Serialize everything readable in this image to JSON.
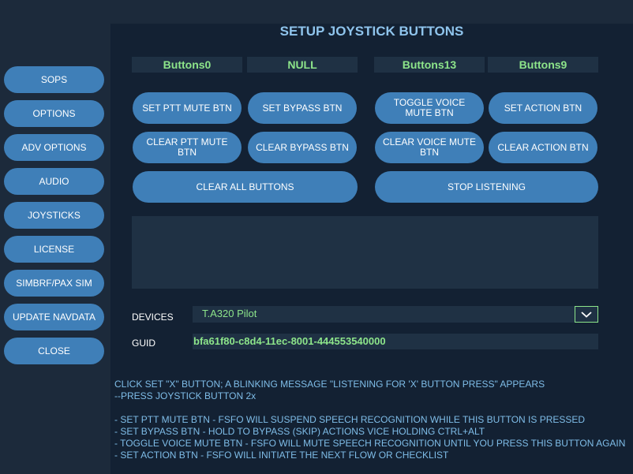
{
  "title": "SETUP JOYSTICK BUTTONS",
  "sidebar": {
    "items": [
      {
        "label": "SOPS"
      },
      {
        "label": "OPTIONS"
      },
      {
        "label": "ADV OPTIONS"
      },
      {
        "label": "AUDIO"
      },
      {
        "label": "JOYSTICKS"
      },
      {
        "label": "LICENSE"
      },
      {
        "label": "SIMBRF/PAX SIM"
      },
      {
        "label": "UPDATE NAVDATA"
      },
      {
        "label": "CLOSE"
      }
    ]
  },
  "assigned": {
    "ptt_mute": "Buttons0",
    "bypass": "NULL",
    "voice_mute": "Buttons13",
    "action": "Buttons9"
  },
  "actions": {
    "set_ptt": "SET PTT MUTE BTN",
    "set_bypass": "SET BYPASS BTN",
    "toggle_voice": "TOGGLE VOICE MUTE BTN",
    "set_action": "SET ACTION BTN",
    "clear_ptt": "CLEAR PTT MUTE BTN",
    "clear_bypass": "CLEAR BYPASS BTN",
    "clear_voice": "CLEAR VOICE MUTE BTN",
    "clear_action": "CLEAR ACTION BTN",
    "clear_all": "CLEAR ALL BUTTONS",
    "stop_listening": "STOP LISTENING"
  },
  "devices": {
    "label": "DEVICES",
    "selected": "T.A320 Pilot"
  },
  "guid": {
    "label": "GUID",
    "value": "bfa61f80-c8d4-11ec-8001-444553540000"
  },
  "help": {
    "line1": "CLICK SET \"X\" BUTTON; A BLINKING MESSAGE \"LISTENING FOR 'X' BUTTON PRESS\"  APPEARS",
    "line2": "--PRESS JOYSTICK BUTTON 2x",
    "notes": [
      "- SET PTT MUTE BTN - FSFO WILL SUSPEND SPEECH RECOGNITION WHILE THIS BUTTON IS PRESSED",
      "- SET BYPASS BTN - HOLD TO BYPASS (SKIP) ACTIONS VICE HOLDING CTRL+ALT",
      "- TOGGLE VOICE MUTE BTN - FSFO WILL MUTE SPEECH RECOGNITION UNTIL YOU PRESS THIS BUTTON AGAIN",
      "- SET ACTION BTN - FSFO WILL INITIATE THE NEXT FLOW OR CHECKLIST"
    ]
  },
  "colors": {
    "button": "#3f7fb8",
    "accent_green": "#8de58a",
    "text_blue": "#7fbde8",
    "background": "#132133"
  }
}
